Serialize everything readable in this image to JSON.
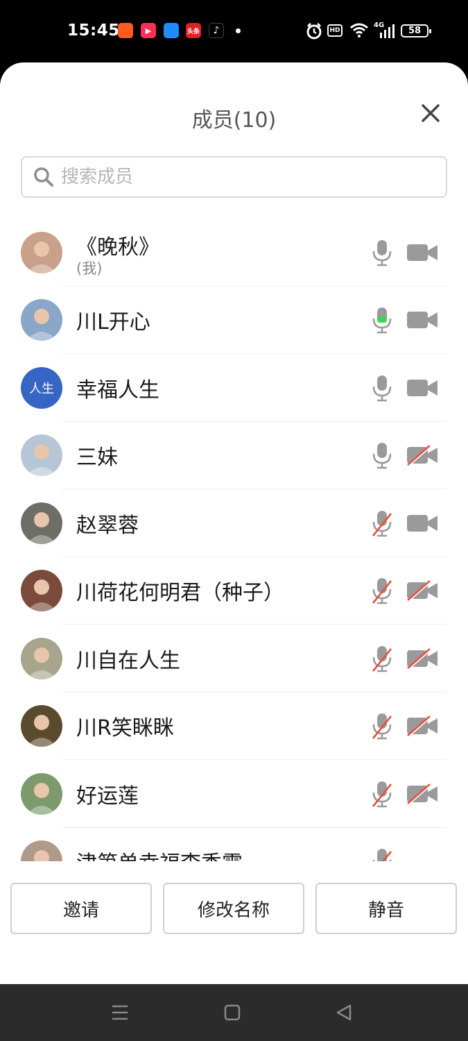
{
  "status_bar": {
    "time": "15:45",
    "apps": [
      {
        "icon": "kuaishou-icon",
        "color": "#ff5a1f",
        "label": ""
      },
      {
        "icon": "video-play-icon",
        "color": "#ff2d55",
        "label": ""
      },
      {
        "icon": "browser-icon",
        "color": "#1e8bff",
        "label": ""
      },
      {
        "icon": "toutiao-icon",
        "color": "#e02020",
        "label": "头条"
      },
      {
        "icon": "tiktok-icon",
        "color": "#000000",
        "label": ""
      }
    ],
    "hd_label": "HD",
    "network_label": "4G",
    "battery": "58"
  },
  "panel": {
    "title": "成员(10)",
    "close_icon": "close-icon",
    "search_placeholder": "搜索成员"
  },
  "members": [
    {
      "name": "《晚秋》",
      "sub": "(我)",
      "avatar": "photo",
      "avatar_color": "#c9a08a",
      "mic": "on",
      "mic_active": false,
      "cam": "on"
    },
    {
      "name": "川L开心",
      "sub": "",
      "avatar": "photo",
      "avatar_color": "#8aa6c9",
      "mic": "on",
      "mic_active": true,
      "cam": "on"
    },
    {
      "name": "幸福人生",
      "sub": "",
      "avatar": "text",
      "avatar_text": "人生",
      "avatar_color": "#3566c4",
      "mic": "on",
      "mic_active": false,
      "cam": "on"
    },
    {
      "name": "三妹",
      "sub": "",
      "avatar": "photo",
      "avatar_color": "#b7c6d6",
      "mic": "on",
      "mic_active": false,
      "cam": "off"
    },
    {
      "name": "赵翠蓉",
      "sub": "",
      "avatar": "photo",
      "avatar_color": "#6d6e66",
      "mic": "off",
      "mic_active": false,
      "cam": "on"
    },
    {
      "name": "川荷花何明君（种子）",
      "sub": "",
      "avatar": "photo",
      "avatar_color": "#7a4a3a",
      "mic": "off",
      "mic_active": false,
      "cam": "off"
    },
    {
      "name": "川自在人生",
      "sub": "",
      "avatar": "photo",
      "avatar_color": "#a8a58e",
      "mic": "off",
      "mic_active": false,
      "cam": "off"
    },
    {
      "name": "川R笑眯眯",
      "sub": "",
      "avatar": "photo",
      "avatar_color": "#5a4a2e",
      "mic": "off",
      "mic_active": false,
      "cam": "off"
    },
    {
      "name": "好运莲",
      "sub": "",
      "avatar": "photo",
      "avatar_color": "#7c9a6c",
      "mic": "off",
      "mic_active": false,
      "cam": "off"
    },
    {
      "name": "津第单幸福李秀霞",
      "sub": "",
      "avatar": "photo",
      "avatar_color": "#b09b8a",
      "mic": "off",
      "mic_active": false,
      "cam": "none"
    }
  ],
  "buttons": {
    "invite": "邀请",
    "rename": "修改名称",
    "mute": "静音"
  },
  "colors": {
    "icon_gray": "#9a9a9a",
    "mute_red": "#e8503a",
    "active_green": "#3fd35a"
  }
}
